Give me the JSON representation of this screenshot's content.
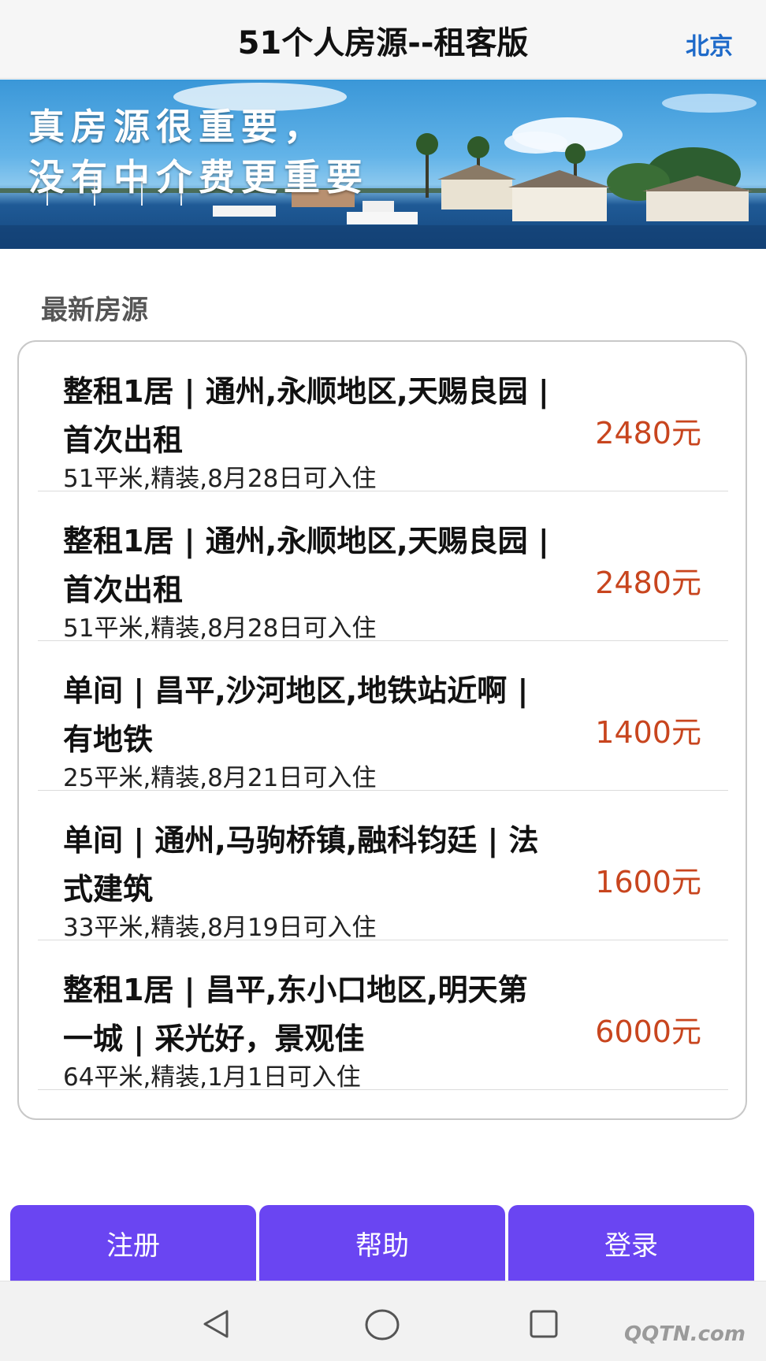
{
  "header": {
    "title": "51个人房源--租客版",
    "city": "北京"
  },
  "banner": {
    "line1": "真房源很重要，",
    "line2": "没有中介费更重要"
  },
  "section": {
    "title": "最新房源"
  },
  "listings": [
    {
      "title": "整租1居 | 通州,永顺地区,天赐良园 | 首次出租",
      "meta": "51平米,精装,8月28日可入住",
      "price": "2480元"
    },
    {
      "title": "整租1居 | 通州,永顺地区,天赐良园 | 首次出租",
      "meta": "51平米,精装,8月28日可入住",
      "price": "2480元"
    },
    {
      "title": "单间 | 昌平,沙河地区,地铁站近啊 | 有地铁",
      "meta": "25平米,精装,8月21日可入住",
      "price": "1400元"
    },
    {
      "title": "单间 | 通州,马驹桥镇,融科钧廷 | 法式建筑",
      "meta": "33平米,精装,8月19日可入住",
      "price": "1600元"
    },
    {
      "title": "整租1居 | 昌平,东小口地区,明天第一城 | 采光好，景观佳",
      "meta": "64平米,精装,1月1日可入住",
      "price": "6000元"
    }
  ],
  "bottom_bar": {
    "register": "注册",
    "help": "帮助",
    "login": "登录"
  },
  "system_nav": {
    "back_icon": "triangle-back-icon",
    "home_icon": "circle-home-icon",
    "recents_icon": "square-recents-icon"
  },
  "watermark": "QQTN.com",
  "colors": {
    "accent": "#6a45f2",
    "price": "#c8451e",
    "city_link": "#1e6ac9"
  }
}
